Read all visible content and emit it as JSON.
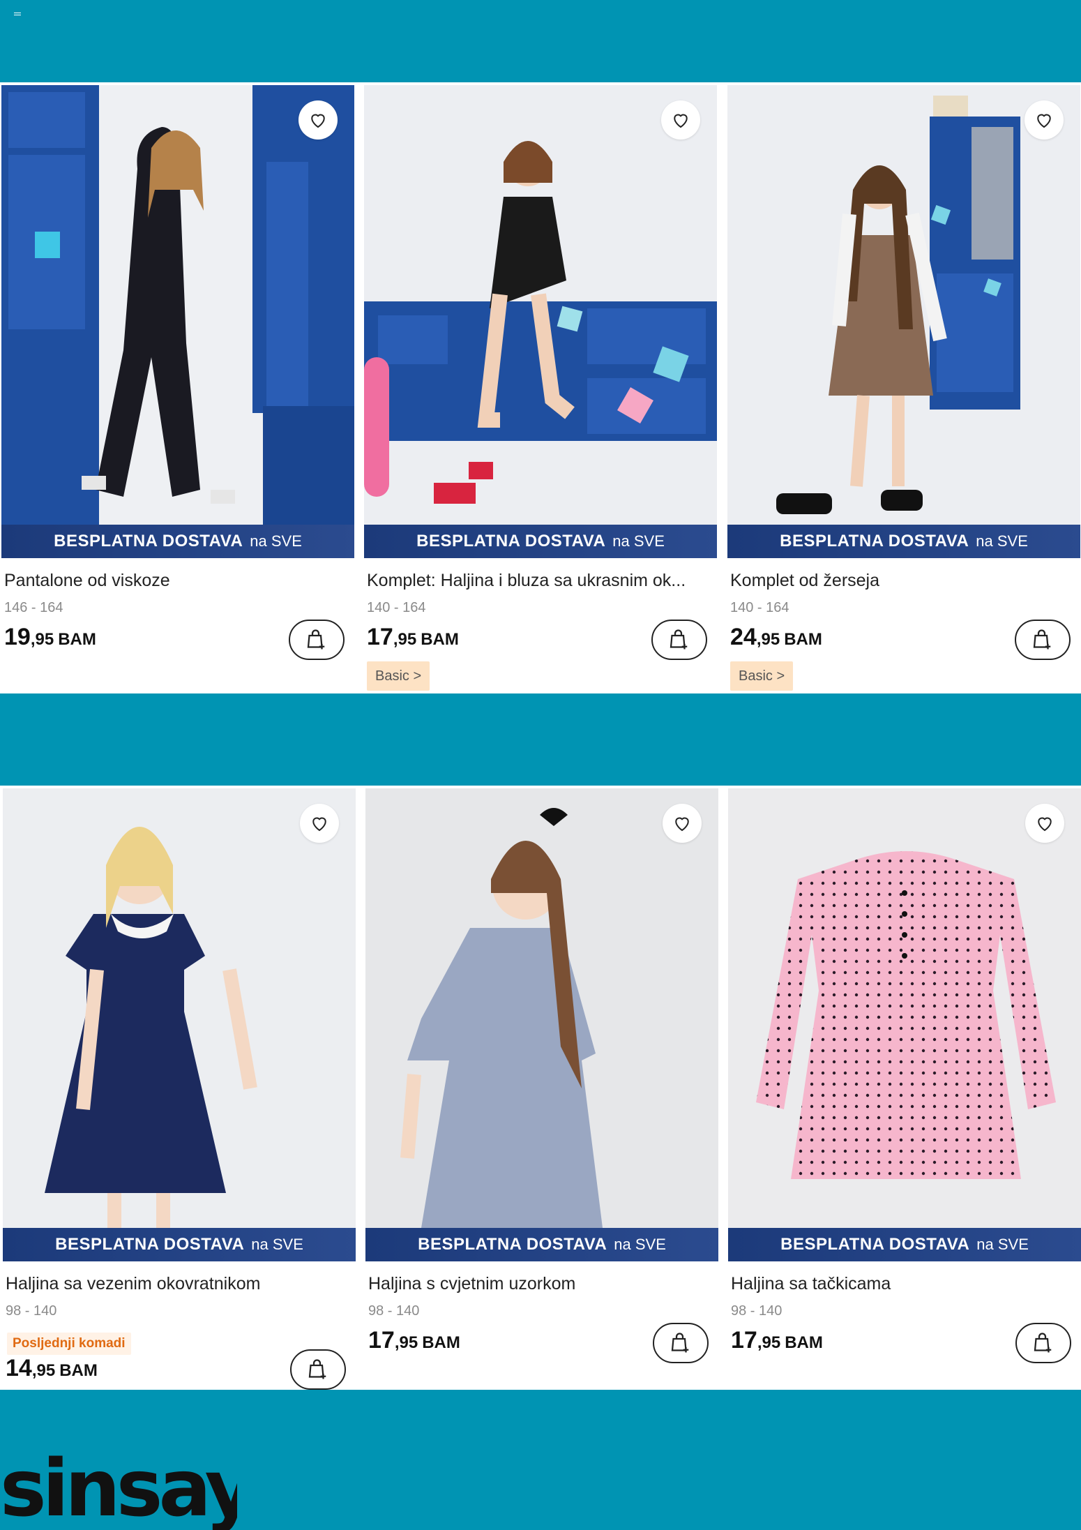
{
  "promo": {
    "strong": "BESPLATNA DOSTAVA",
    "light": "na SVE"
  },
  "colors": {
    "teal": "#0094b3",
    "promo_blue": "#1c3a7a",
    "tag_peach": "#fde2c4",
    "last_orange": "#e06a12"
  },
  "products": [
    {
      "name": "Pantalone od viskoze",
      "sizes": "146 - 164",
      "price_main": "19",
      "price_cents": ",95",
      "currency": "BAM",
      "tag": ""
    },
    {
      "name": "Komplet: Haljina i bluza sa ukrasnim ok...",
      "sizes": "140 - 164",
      "price_main": "17",
      "price_cents": ",95",
      "currency": "BAM",
      "tag": "Basic >"
    },
    {
      "name": "Komplet od žerseja",
      "sizes": "140 - 164",
      "price_main": "24",
      "price_cents": ",95",
      "currency": "BAM",
      "tag": "Basic >"
    },
    {
      "name": "Haljina sa vezenim okovratnikom",
      "sizes": "98 - 140",
      "price_main": "14",
      "price_cents": ",95",
      "currency": "BAM",
      "tag": "",
      "badge": "Posljednji komadi"
    },
    {
      "name": "Haljina s cvjetnim uzorkom",
      "sizes": "98 - 140",
      "price_main": "17",
      "price_cents": ",95",
      "currency": "BAM",
      "tag": ""
    },
    {
      "name": "Haljina sa tačkicama",
      "sizes": "98 - 140",
      "price_main": "17",
      "price_cents": ",95",
      "currency": "BAM",
      "tag": ""
    }
  ],
  "icons": {
    "favorite": "heart-icon",
    "cart": "add-to-cart-icon",
    "menu": "menu-icon"
  },
  "brand": {
    "logo_text": "sinsay"
  }
}
